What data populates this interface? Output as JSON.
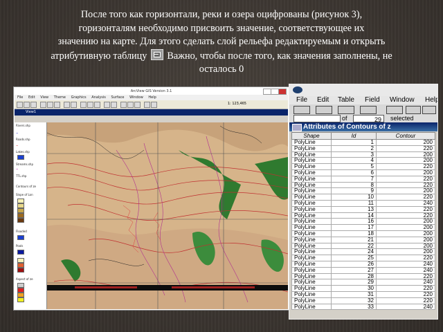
{
  "caption": {
    "line1": "После того как горизонтали, реки и озера оцифрованы (рисунок 3),",
    "line2": "горизонталям необходимо присвоить значение, соответствующее их",
    "line3": "значению на карте. Для этого сделать слой рельефа редактируемым и открыть",
    "line4a": "атрибутивную таблицу",
    "line4b": "Важно, чтобы после того, как значения заполнены, не",
    "line5": "осталось 0",
    "icon": "table-icon"
  },
  "arcview": {
    "title": "ArcView GIS Version 3.1",
    "menu": [
      "File",
      "Edit",
      "View",
      "Theme",
      "Graphics",
      "Analysis",
      "Surface",
      "Window",
      "Help"
    ],
    "scale": "1: 123,465",
    "view_title": "View1",
    "legend": [
      "Rivers.shp",
      "Roads.shp",
      "Lakes.shp",
      "Streams.shp",
      "TTL.shp",
      "Contours of ze",
      "Slope of Lon",
      "Flooded",
      "Pools",
      "Aspect of ze"
    ]
  },
  "attr": {
    "menu": [
      "File",
      "Edit",
      "Table",
      "Field",
      "Window",
      "Help"
    ],
    "status_count": "29",
    "status_of": "of",
    "status_selected": "selected",
    "title": "Attributes of Contours of z",
    "columns": [
      "Shape",
      "Id",
      "Contour"
    ],
    "rows": [
      {
        "shape": "PolyLine",
        "id": "1",
        "contour": "200"
      },
      {
        "shape": "PolyLine",
        "id": "2",
        "contour": "220"
      },
      {
        "shape": "PolyLine",
        "id": "3",
        "contour": "200"
      },
      {
        "shape": "PolyLine",
        "id": "4",
        "contour": "200"
      },
      {
        "shape": "PolyLine",
        "id": "5",
        "contour": "220"
      },
      {
        "shape": "PolyLine",
        "id": "6",
        "contour": "200"
      },
      {
        "shape": "PolyLine",
        "id": "7",
        "contour": "220"
      },
      {
        "shape": "PolyLine",
        "id": "8",
        "contour": "220"
      },
      {
        "shape": "PolyLine",
        "id": "9",
        "contour": "200"
      },
      {
        "shape": "PolyLine",
        "id": "10",
        "contour": "220"
      },
      {
        "shape": "PolyLine",
        "id": "11",
        "contour": "240"
      },
      {
        "shape": "PolyLine",
        "id": "13",
        "contour": "220"
      },
      {
        "shape": "PolyLine",
        "id": "14",
        "contour": "220"
      },
      {
        "shape": "PolyLine",
        "id": "16",
        "contour": "200"
      },
      {
        "shape": "PolyLine",
        "id": "17",
        "contour": "200"
      },
      {
        "shape": "PolyLine",
        "id": "18",
        "contour": "200"
      },
      {
        "shape": "PolyLine",
        "id": "21",
        "contour": "200"
      },
      {
        "shape": "PolyLine",
        "id": "22",
        "contour": "200"
      },
      {
        "shape": "PolyLine",
        "id": "24",
        "contour": "200"
      },
      {
        "shape": "PolyLine",
        "id": "25",
        "contour": "220"
      },
      {
        "shape": "PolyLine",
        "id": "26",
        "contour": "240"
      },
      {
        "shape": "PolyLine",
        "id": "27",
        "contour": "240"
      },
      {
        "shape": "PolyLine",
        "id": "28",
        "contour": "220"
      },
      {
        "shape": "PolyLine",
        "id": "29",
        "contour": "240"
      },
      {
        "shape": "PolyLine",
        "id": "30",
        "contour": "220"
      },
      {
        "shape": "PolyLine",
        "id": "31",
        "contour": "220"
      },
      {
        "shape": "PolyLine",
        "id": "32",
        "contour": "220"
      },
      {
        "shape": "PolyLine",
        "id": "33",
        "contour": "240"
      }
    ]
  }
}
